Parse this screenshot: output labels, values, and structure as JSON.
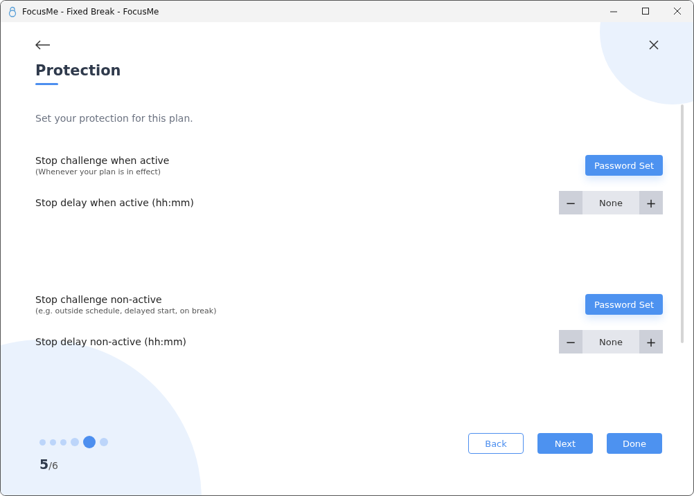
{
  "window": {
    "title": "FocusMe - Fixed Break - FocusMe"
  },
  "page": {
    "title": "Protection",
    "intro": "Set your protection for this plan."
  },
  "settings": [
    {
      "kind": "challenge",
      "label": "Stop challenge when active",
      "hint": "(Whenever your plan is in effect)",
      "button": "Password Set"
    },
    {
      "kind": "delay",
      "label": "Stop delay when active (hh:mm)",
      "minus": "−",
      "value": "None",
      "plus": "+"
    },
    {
      "kind": "challenge",
      "label": "Stop challenge non-active",
      "hint": "(e.g. outside schedule, delayed start, on break)",
      "button": "Password Set"
    },
    {
      "kind": "delay",
      "label": "Stop delay non-active (hh:mm)",
      "minus": "−",
      "value": "None",
      "plus": "+"
    }
  ],
  "steps": [
    {
      "selected": false
    },
    {
      "selected": false
    },
    {
      "selected": false
    },
    {
      "selected": false
    },
    {
      "selected": true
    },
    {
      "selected": false
    }
  ],
  "step_counter": {
    "current": "5",
    "total": "/6"
  },
  "buttons": {
    "back": "Back",
    "next": "Next",
    "done": "Done"
  }
}
